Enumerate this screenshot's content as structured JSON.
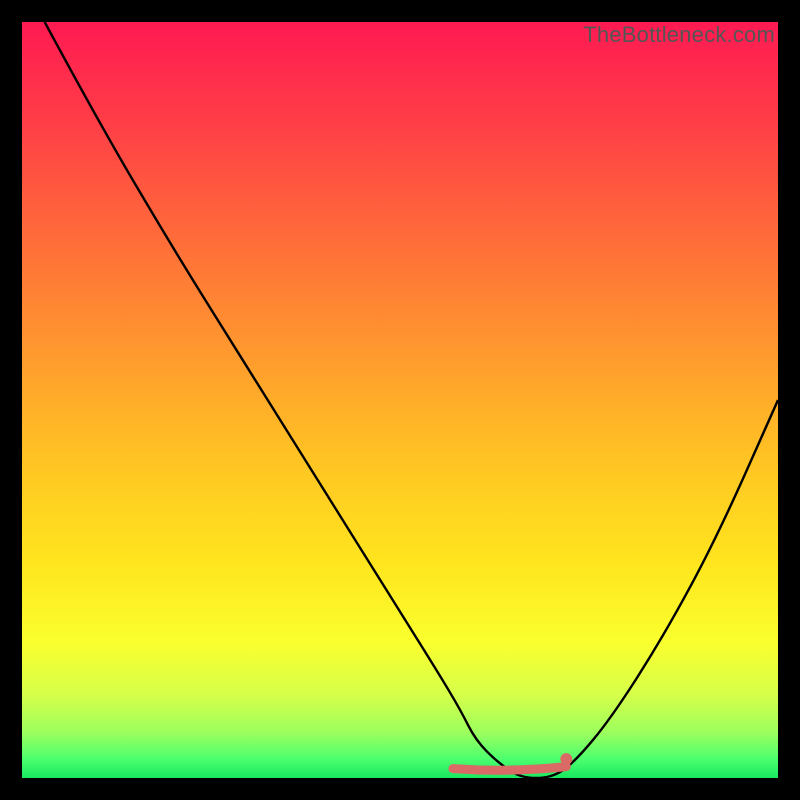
{
  "watermark": "TheBottleneck.com",
  "chart_data": {
    "type": "line",
    "title": "",
    "xlabel": "",
    "ylabel": "",
    "xlim": [
      0,
      100
    ],
    "ylim": [
      0,
      100
    ],
    "grid": false,
    "series": [
      {
        "name": "bottleneck-curve",
        "x": [
          3,
          10,
          20,
          30,
          40,
          50,
          55,
          58,
          60,
          63,
          66,
          70,
          73,
          78,
          85,
          92,
          100
        ],
        "values": [
          100,
          87,
          70,
          54,
          38,
          22,
          14,
          9,
          5,
          2,
          0,
          0,
          2,
          8,
          19,
          32,
          50
        ]
      }
    ],
    "flat_region": {
      "x_start": 57,
      "x_end": 72,
      "y": 1.5,
      "color": "#d96a66"
    },
    "marker": {
      "x": 72,
      "y": 2.5,
      "color": "#d96a66"
    },
    "gradient_stops": [
      {
        "offset": 0.0,
        "color": "#ff1a52"
      },
      {
        "offset": 0.12,
        "color": "#ff3a48"
      },
      {
        "offset": 0.28,
        "color": "#ff6a3a"
      },
      {
        "offset": 0.44,
        "color": "#ff9a2e"
      },
      {
        "offset": 0.58,
        "color": "#ffc423"
      },
      {
        "offset": 0.72,
        "color": "#ffe61e"
      },
      {
        "offset": 0.82,
        "color": "#faff2e"
      },
      {
        "offset": 0.89,
        "color": "#d6ff4a"
      },
      {
        "offset": 0.94,
        "color": "#9cff5e"
      },
      {
        "offset": 0.975,
        "color": "#4cff6e"
      },
      {
        "offset": 1.0,
        "color": "#18e860"
      }
    ]
  }
}
